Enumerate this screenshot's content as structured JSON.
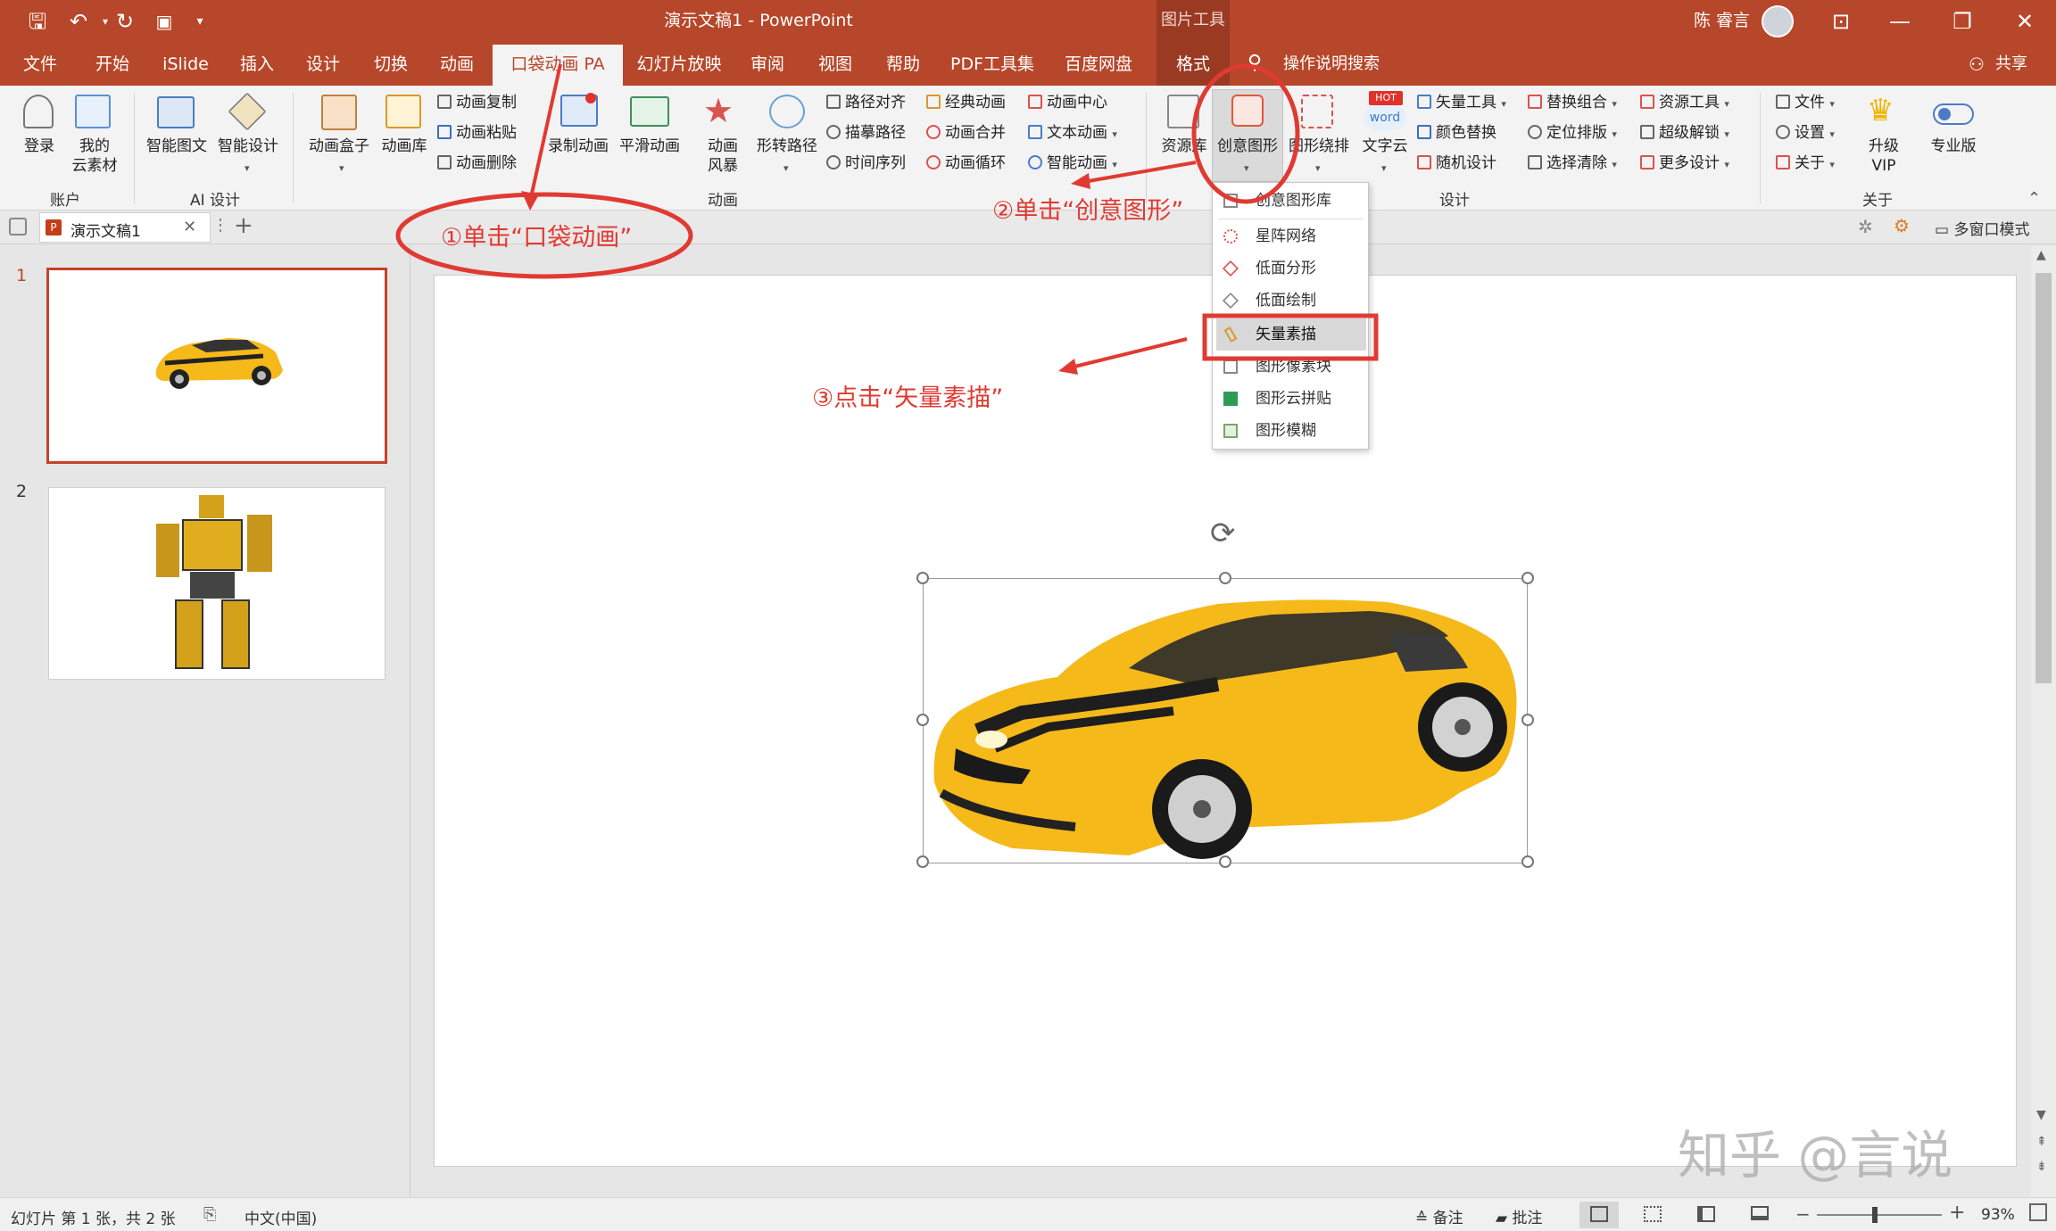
{
  "window": {
    "title": "演示文稿1 - PowerPoint",
    "context_tool": "图片工具",
    "user_name": "陈 睿言"
  },
  "tabs": [
    "文件",
    "开始",
    "iSlide",
    "插入",
    "设计",
    "切换",
    "动画",
    "口袋动画 PA",
    "幻灯片放映",
    "审阅",
    "视图",
    "帮助",
    "PDF工具集",
    "百度网盘",
    "格式"
  ],
  "active_tab": "口袋动画 PA",
  "search": {
    "label": "操作说明搜索"
  },
  "share": {
    "label": "共享"
  },
  "ribbon": {
    "account": {
      "login": "登录",
      "my_line1": "我的",
      "my_line2": "云素材",
      "group": "账户"
    },
    "ai": {
      "smart_graphic": "智能图文",
      "smart_design": "智能设计",
      "group": "AI 设计"
    },
    "anim": {
      "box": "动画盒子",
      "lib": "动画库",
      "copy": "动画复制",
      "paste": "动画粘贴",
      "delete": "动画删除",
      "record": "录制动画",
      "smooth": "平滑动画",
      "storm_line1": "动画",
      "storm_line2": "风暴",
      "path_shape": "形转路径",
      "path_align": "路径对齐",
      "trace_path": "描摹路径",
      "timeline": "时间序列",
      "classic": "经典动画",
      "merge": "动画合并",
      "loop": "动画循环",
      "center": "动画中心",
      "text": "文本动画",
      "smart": "智能动画",
      "group": "动画"
    },
    "design": {
      "resource": "资源库",
      "creative": "创意图形",
      "shape_wrap": "图形绕排",
      "word_cloud": "文字云",
      "vector": "矢量工具",
      "color_replace": "颜色替换",
      "random": "随机设计",
      "replace_group": "替换组合",
      "position": "定位排版",
      "select_clear": "选择清除",
      "resource_tools": "资源工具",
      "super_unlock": "超级解锁",
      "more_design": "更多设计",
      "hot_badge": "HOT",
      "word_badge": "word",
      "group": "设计"
    },
    "about": {
      "file": "文件",
      "settings": "设置",
      "about": "关于",
      "upgrade_line1": "升级",
      "upgrade_line2": "VIP",
      "pro": "专业版",
      "group": "关于"
    }
  },
  "doc_tab": {
    "name": "演示文稿1",
    "multi_window": "多窗口模式"
  },
  "slides": [
    {
      "number": "1"
    },
    {
      "number": "2"
    }
  ],
  "dropdown": {
    "items": [
      "创意图形库",
      "星阵网络",
      "低面分形",
      "低面绘制",
      "矢量素描",
      "图形像素块",
      "图形云拼贴",
      "图形模糊"
    ],
    "highlighted": "矢量素描"
  },
  "annotations": {
    "step1": "①单击“口袋动画”",
    "step2": "②单击“创意图形”",
    "step3": "③点击“矢量素描”"
  },
  "watermark": "知乎 @言说",
  "status": {
    "slide_info": "幻灯片 第 1 张，共 2 张",
    "language": "中文(中国)",
    "notes": "备注",
    "comments": "批注",
    "zoom": "93%"
  },
  "colors": {
    "accent": "#b7472a",
    "annotation": "#e03a32",
    "car_yellow": "#f5b91a"
  }
}
